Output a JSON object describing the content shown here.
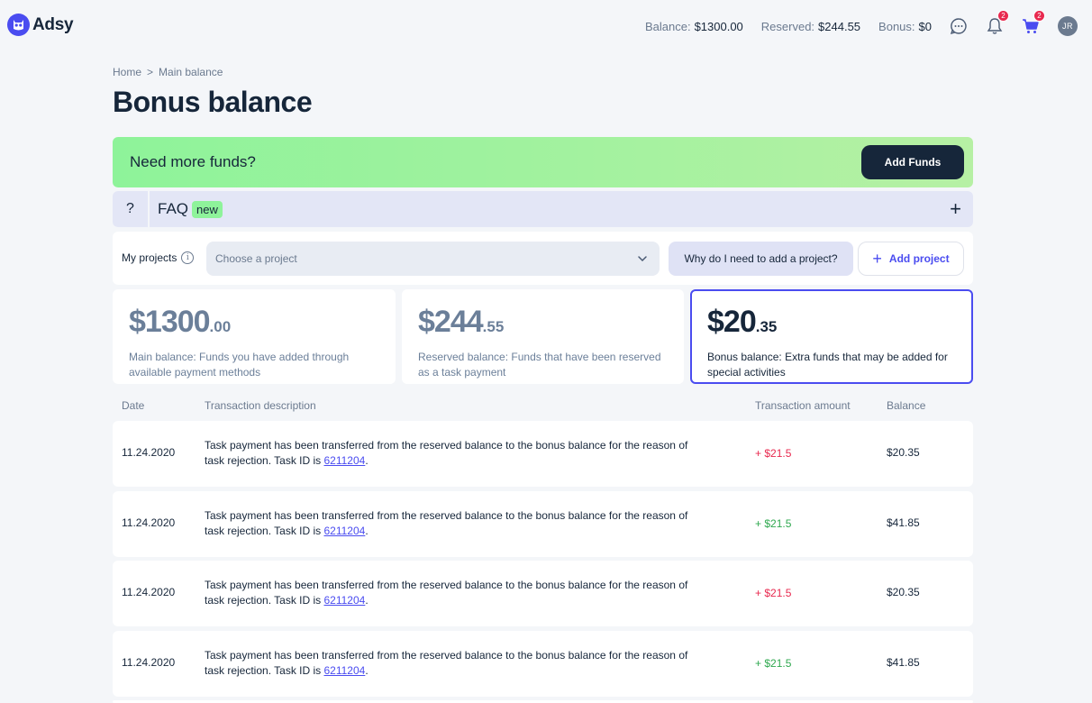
{
  "app": {
    "name": "Adsy"
  },
  "header": {
    "balance_label": "Balance:",
    "balance_value": "$1300.00",
    "reserved_label": "Reserved:",
    "reserved_value": "$244.55",
    "bonus_label": "Bonus:",
    "bonus_value": "$0",
    "notifications_count": "2",
    "cart_count": "2",
    "avatar_initials": "JR"
  },
  "breadcrumb": {
    "home": "Home",
    "separator": ">",
    "current": "Main balance"
  },
  "page": {
    "title": "Bonus balance"
  },
  "funds_banner": {
    "text": "Need more funds?",
    "button": "Add Funds"
  },
  "faq": {
    "icon": "?",
    "label": "FAQ",
    "badge": "new",
    "toggle": "+"
  },
  "projects": {
    "label": "My projects",
    "select_placeholder": "Choose a project",
    "why_button": "Why do I need to add a project?",
    "add_button": "Add project"
  },
  "cards": [
    {
      "whole": "$1300",
      "cents": ".00",
      "desc": "Main balance: Funds you have added through available payment methods"
    },
    {
      "whole": "$244",
      "cents": ".55",
      "desc": "Reserved balance: Funds that have been reserved as a task payment"
    },
    {
      "whole": "$20",
      "cents": ".35",
      "desc": "Bonus balance: Extra funds that may be added for special activities"
    }
  ],
  "table": {
    "headers": {
      "date": "Date",
      "description": "Transaction description",
      "amount": "Transaction amount",
      "balance": "Balance"
    },
    "rows": [
      {
        "date": "11.24.2020",
        "desc": "Task payment has been transferred from the reserved balance to the bonus balance for the reason of task rejection. Task ID is ",
        "task_id": "6211204",
        "period": ".",
        "amount": "+ $21.5",
        "balance": "$20.35"
      },
      {
        "date": "11.24.2020",
        "desc": "Task payment has been transferred from the reserved balance to the bonus balance for the reason of task rejection. Task ID is ",
        "task_id": "6211204",
        "period": ".",
        "amount": "+ $21.5",
        "balance": "$41.85"
      },
      {
        "date": "11.24.2020",
        "desc": "Task payment has been transferred from the reserved balance to the bonus balance for the reason of task rejection. Task ID is ",
        "task_id": "6211204",
        "period": ".",
        "amount": "+ $21.5",
        "balance": "$20.35"
      },
      {
        "date": "11.24.2020",
        "desc": "Task payment has been transferred from the reserved balance to the bonus balance for the reason of task rejection. Task ID is ",
        "task_id": "6211204",
        "period": ".",
        "amount": "+ $21.5",
        "balance": "$41.85"
      }
    ]
  },
  "colors": {
    "accent": "#4a4cf0",
    "positive_green": "#2fa84f",
    "negative_red": "#e8294f",
    "dark": "#16263a"
  }
}
